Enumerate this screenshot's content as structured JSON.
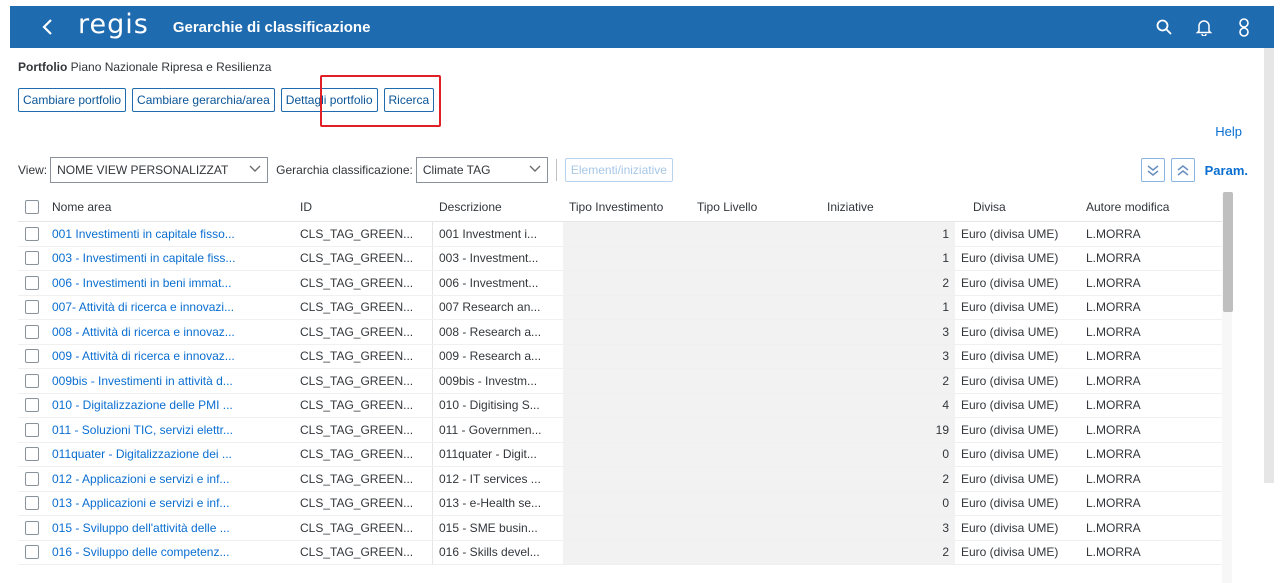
{
  "header": {
    "logo": "regis",
    "title": "Gerarchie di classificazione",
    "bg_color": "#1f6bb0"
  },
  "portfolio": {
    "label": "Portfolio",
    "value": "Piano Nazionale Ripresa e Resilienza"
  },
  "buttons": {
    "change_portfolio": "Cambiare portfolio",
    "change_hierarchy": "Cambiare gerarchia/area",
    "portfolio_details": "Dettagli portfolio",
    "search": "Ricerca"
  },
  "help": "Help",
  "toolbar": {
    "view_label": "View:",
    "view_value": "NOME VIEW PERSONALIZZAT",
    "hierarchy_label": "Gerarchia classificazione:",
    "hierarchy_value": "Climate TAG",
    "elements_button": "Elementi/iniziative",
    "param": "Param."
  },
  "table": {
    "columns": [
      "Nome area",
      "ID",
      "Descrizione",
      "Tipo Investimento",
      "Tipo Livello",
      "Iniziative",
      "Divisa",
      "Autore modifica"
    ],
    "rows": [
      {
        "name": "001 Investimenti in capitale fisso...",
        "id": "CLS_TAG_GREEN...",
        "desc": "001 Investment i...",
        "tinv": "",
        "tliv": "",
        "iniz": "1",
        "divisa": "Euro (divisa UME)",
        "autore": "L.MORRA"
      },
      {
        "name": "003 - Investimenti in capitale fiss...",
        "id": "CLS_TAG_GREEN...",
        "desc": "003 - Investment...",
        "tinv": "",
        "tliv": "",
        "iniz": "1",
        "divisa": "Euro (divisa UME)",
        "autore": "L.MORRA"
      },
      {
        "name": "006 - Investimenti in beni immat...",
        "id": "CLS_TAG_GREEN...",
        "desc": "006 - Investment...",
        "tinv": "",
        "tliv": "",
        "iniz": "2",
        "divisa": "Euro (divisa UME)",
        "autore": "L.MORRA"
      },
      {
        "name": "007- Attività di ricerca e innovazi...",
        "id": "CLS_TAG_GREEN...",
        "desc": "007 Research an...",
        "tinv": "",
        "tliv": "",
        "iniz": "1",
        "divisa": "Euro (divisa UME)",
        "autore": "L.MORRA"
      },
      {
        "name": "008 - Attività di ricerca e innovaz...",
        "id": "CLS_TAG_GREEN...",
        "desc": "008 - Research a...",
        "tinv": "",
        "tliv": "",
        "iniz": "3",
        "divisa": "Euro (divisa UME)",
        "autore": "L.MORRA"
      },
      {
        "name": "009 - Attività di ricerca e innovaz...",
        "id": "CLS_TAG_GREEN...",
        "desc": "009 - Research a...",
        "tinv": "",
        "tliv": "",
        "iniz": "3",
        "divisa": "Euro (divisa UME)",
        "autore": "L.MORRA"
      },
      {
        "name": "009bis - Investimenti in attività d...",
        "id": "CLS_TAG_GREEN...",
        "desc": "009bis - Investm...",
        "tinv": "",
        "tliv": "",
        "iniz": "2",
        "divisa": "Euro (divisa UME)",
        "autore": "L.MORRA"
      },
      {
        "name": "010 - Digitalizzazione delle PMI ...",
        "id": "CLS_TAG_GREEN...",
        "desc": "010 - Digitising S...",
        "tinv": "",
        "tliv": "",
        "iniz": "4",
        "divisa": "Euro (divisa UME)",
        "autore": "L.MORRA"
      },
      {
        "name": "011 - Soluzioni TIC, servizi elettr...",
        "id": "CLS_TAG_GREEN...",
        "desc": "011 - Governmen...",
        "tinv": "",
        "tliv": "",
        "iniz": "19",
        "divisa": "Euro (divisa UME)",
        "autore": "L.MORRA"
      },
      {
        "name": "011quater - Digitalizzazione dei ...",
        "id": "CLS_TAG_GREEN...",
        "desc": "011quater - Digit...",
        "tinv": "",
        "tliv": "",
        "iniz": "0",
        "divisa": "Euro (divisa UME)",
        "autore": "L.MORRA"
      },
      {
        "name": "012 - Applicazioni e servizi e inf...",
        "id": "CLS_TAG_GREEN...",
        "desc": "012 - IT services ...",
        "tinv": "",
        "tliv": "",
        "iniz": "2",
        "divisa": "Euro (divisa UME)",
        "autore": "L.MORRA"
      },
      {
        "name": "013 - Applicazioni e servizi e inf...",
        "id": "CLS_TAG_GREEN...",
        "desc": "013 - e-Health se...",
        "tinv": "",
        "tliv": "",
        "iniz": "0",
        "divisa": "Euro (divisa UME)",
        "autore": "L.MORRA"
      },
      {
        "name": "015 - Sviluppo dell'attività delle ...",
        "id": "CLS_TAG_GREEN...",
        "desc": "015 - SME busin...",
        "tinv": "",
        "tliv": "",
        "iniz": "3",
        "divisa": "Euro (divisa UME)",
        "autore": "L.MORRA"
      },
      {
        "name": "016 - Sviluppo delle competenz...",
        "id": "CLS_TAG_GREEN...",
        "desc": "016 - Skills devel...",
        "tinv": "",
        "tliv": "",
        "iniz": "2",
        "divisa": "Euro (divisa UME)",
        "autore": "L.MORRA"
      }
    ]
  },
  "colors": {
    "link": "#0a6ed1",
    "highlight_box": "#e01f26"
  }
}
